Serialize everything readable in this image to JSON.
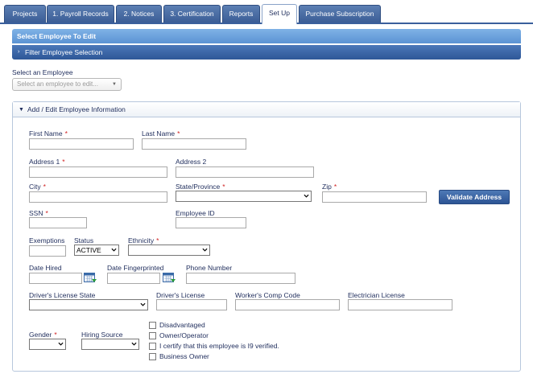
{
  "tabs": [
    {
      "label": "Projects",
      "active": false
    },
    {
      "label": "1. Payroll Records",
      "active": false
    },
    {
      "label": "2. Notices",
      "active": false
    },
    {
      "label": "3. Certification",
      "active": false
    },
    {
      "label": "Reports",
      "active": false
    },
    {
      "label": "Set Up",
      "active": true
    },
    {
      "label": "Purchase Subscription",
      "active": false
    }
  ],
  "select_bar": {
    "title": "Select Employee To Edit"
  },
  "filter_bar": {
    "title": "Filter Employee Selection"
  },
  "employee_select": {
    "label": "Select an Employee",
    "placeholder": "Select an employee to edit..."
  },
  "panel": {
    "title": "Add / Edit Employee Information"
  },
  "form": {
    "first_name": "First Name",
    "last_name": "Last Name",
    "address1": "Address 1",
    "address2": "Address 2",
    "city": "City",
    "state": "State/Province",
    "zip": "Zip",
    "validate_button": "Validate Address",
    "ssn": "SSN",
    "employee_id": "Employee ID",
    "exemptions": "Exemptions",
    "status": "Status",
    "status_value": "ACTIVE",
    "ethnicity": "Ethnicity",
    "date_hired": "Date Hired",
    "date_fingerprinted": "Date Fingerprinted",
    "phone": "Phone Number",
    "dl_state": "Driver's License State",
    "dl": "Driver's License",
    "workers_comp": "Worker's Comp Code",
    "electrician": "Electrician License",
    "gender": "Gender",
    "hiring_source": "Hiring Source",
    "required_mark": "*",
    "checkboxes": [
      "Disadvantaged",
      "Owner/Operator",
      "I certify that this employee is I9 verified.",
      "Business Owner"
    ]
  },
  "colors": {
    "tab_blue": "#3b5d96",
    "bar_light": "#5b93d3",
    "bar_dark": "#2e5797",
    "required": "#d02020"
  }
}
